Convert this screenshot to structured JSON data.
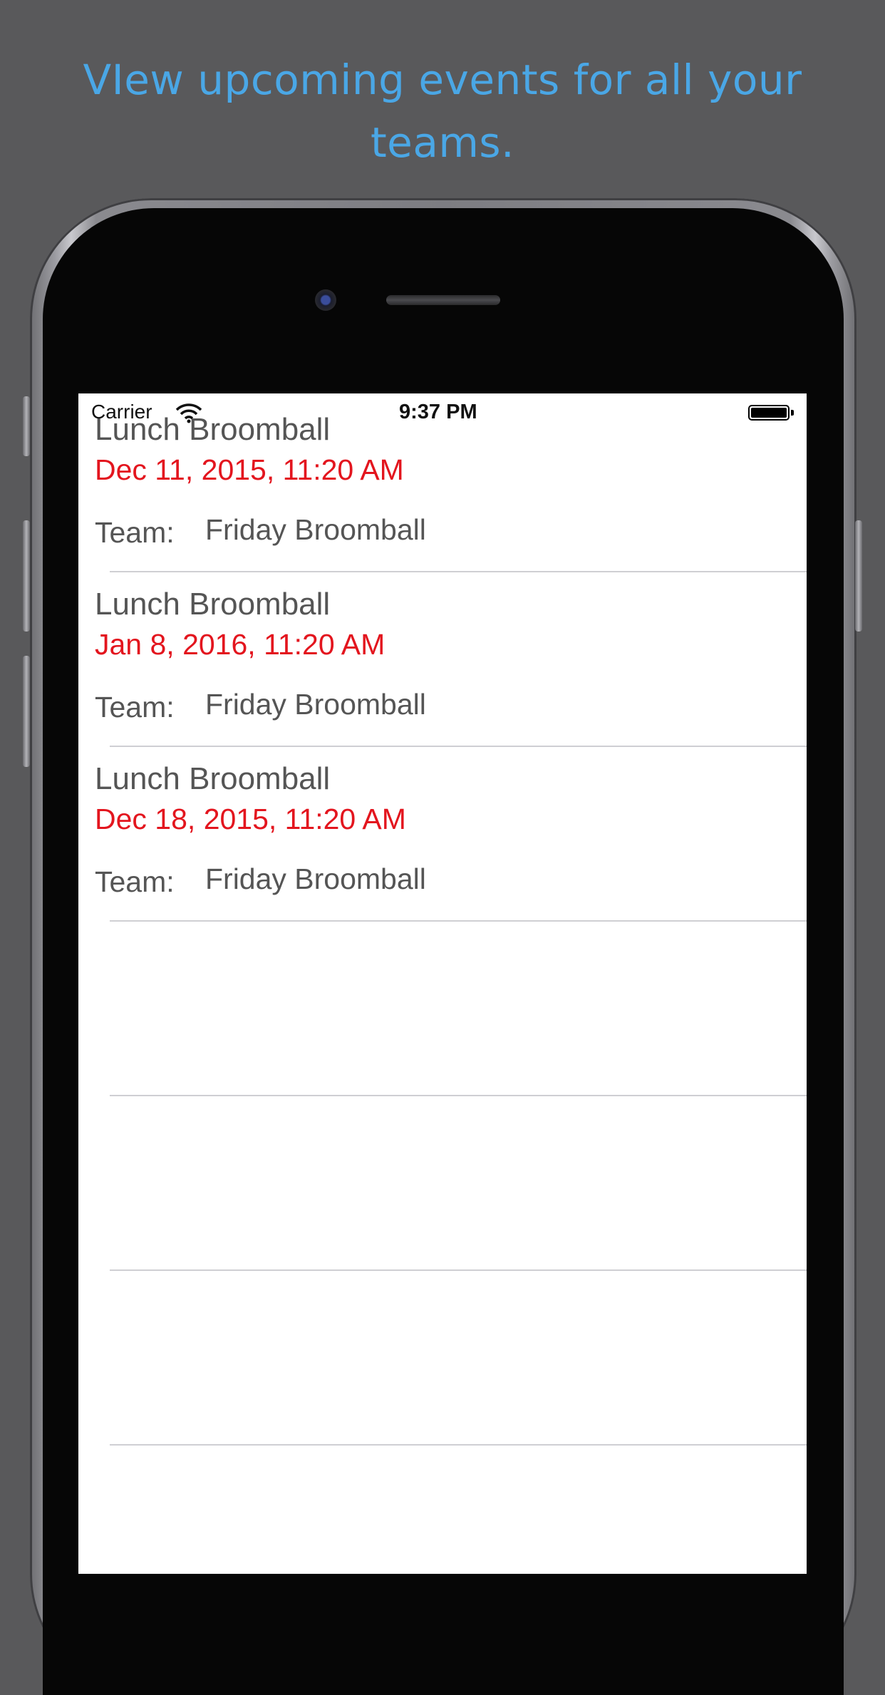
{
  "headline": "VIew upcoming events for all your teams.",
  "status_bar": {
    "carrier": "Carrier",
    "time": "9:37 PM",
    "battery_level": 1.0
  },
  "events": [
    {
      "title": "Lunch Broomball",
      "date": "Dec 11, 2015, 11:20 AM",
      "team_label": "Team:",
      "team": "Friday Broomball"
    },
    {
      "title": "Lunch Broomball",
      "date": "Jan 8, 2016, 11:20 AM",
      "team_label": "Team:",
      "team": "Friday Broomball"
    },
    {
      "title": "Lunch Broomball",
      "date": "Dec 18, 2015, 11:20 AM",
      "team_label": "Team:",
      "team": "Friday Broomball"
    }
  ],
  "colors": {
    "background": "#59595b",
    "headline": "#4aa7e6",
    "date": "#e3151e",
    "text": "#555555",
    "separator": "#cfcfd3"
  },
  "icons": {
    "wifi": "wifi-icon",
    "battery": "battery-icon",
    "camera": "front-camera",
    "speaker": "earpiece-speaker"
  }
}
